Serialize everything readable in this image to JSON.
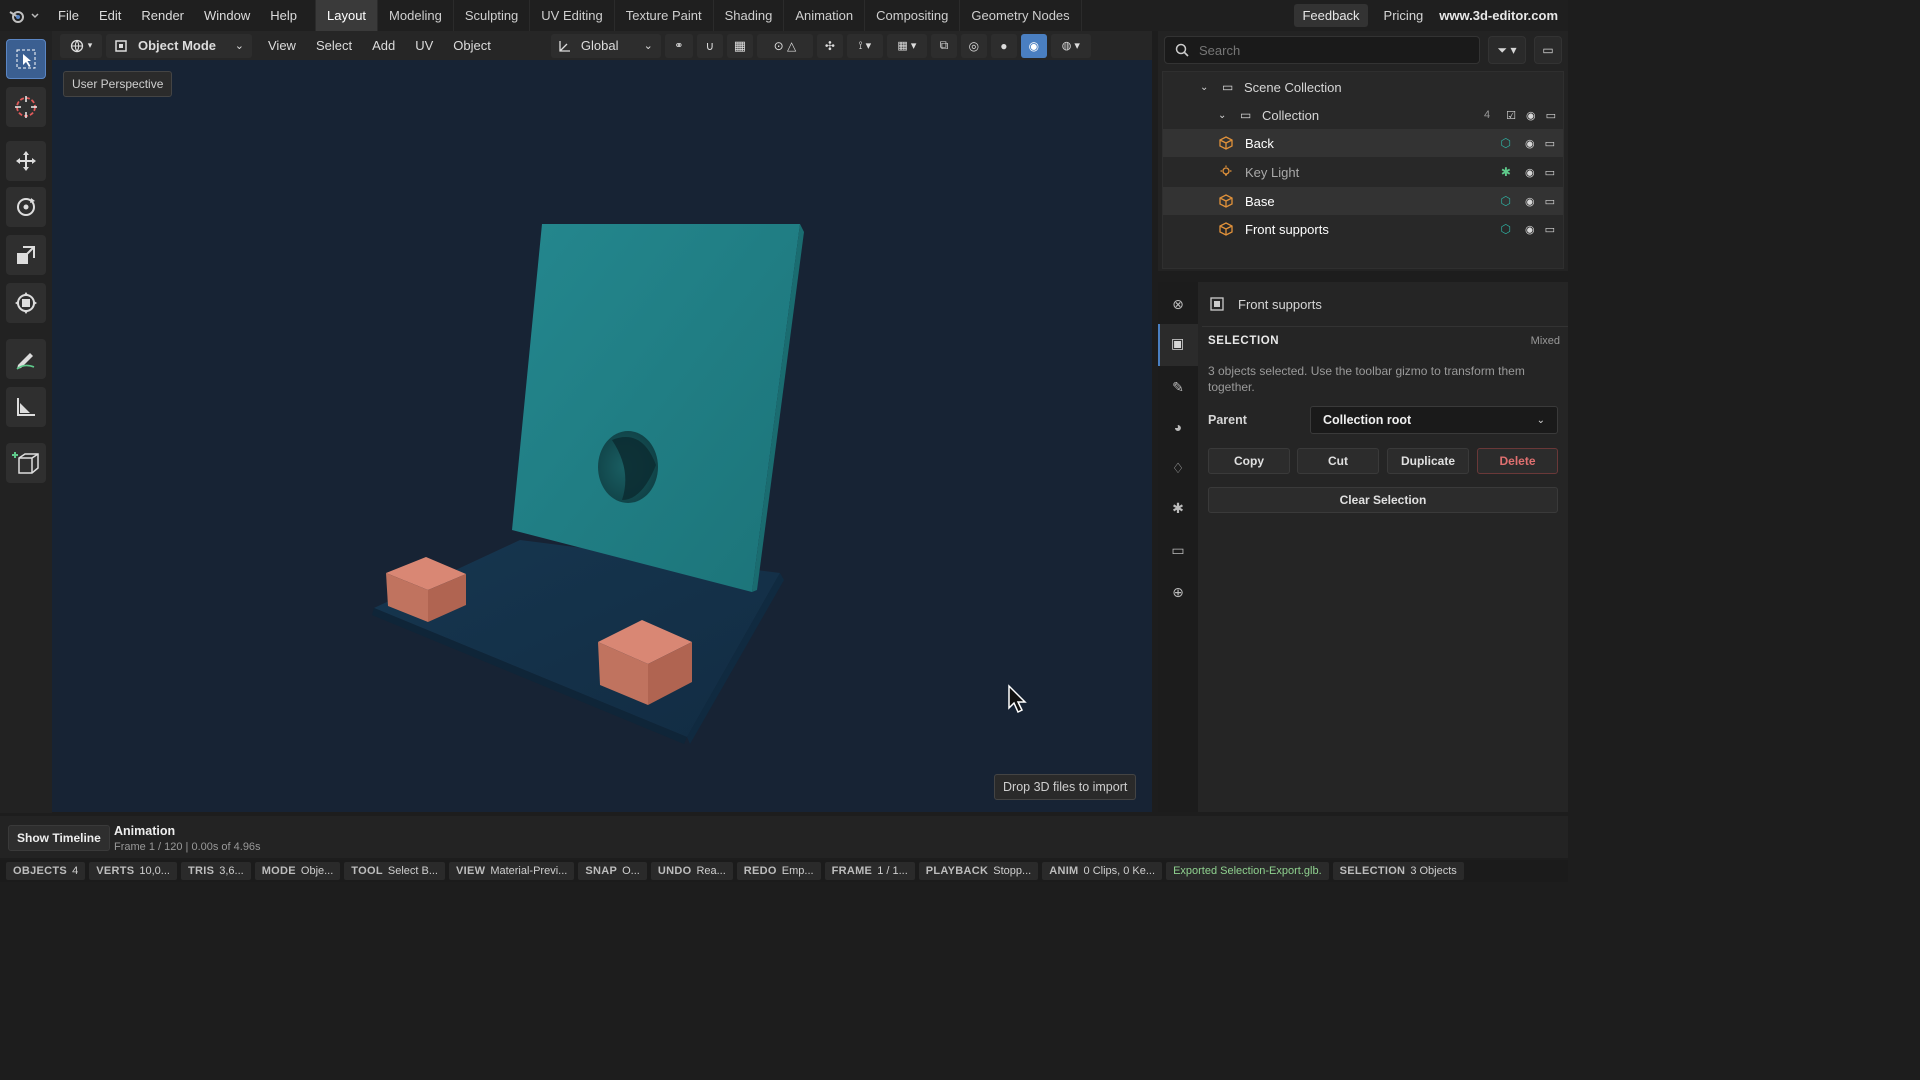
{
  "app": {
    "brand": "www.3d-editor.com"
  },
  "menus": [
    "File",
    "Edit",
    "Render",
    "Window",
    "Help"
  ],
  "workspaces": [
    "Layout",
    "Modeling",
    "Sculpting",
    "UV Editing",
    "Texture Paint",
    "Shading",
    "Animation",
    "Compositing",
    "Geometry Nodes"
  ],
  "active_workspace": "Layout",
  "topright": {
    "feedback": "Feedback",
    "pricing": "Pricing"
  },
  "viewport_header": {
    "mode": "Object Mode",
    "menus": [
      "View",
      "Select",
      "Add",
      "UV",
      "Object"
    ],
    "orientation": "Global"
  },
  "viewport": {
    "perspective_label": "User Perspective",
    "drop_hint": "Drop 3D files to import"
  },
  "outliner": {
    "search_placeholder": "Search",
    "scene_collection": "Scene Collection",
    "collection": "Collection",
    "collection_count": "4",
    "items": [
      {
        "name": "Back",
        "type": "mesh"
      },
      {
        "name": "Key Light",
        "type": "light"
      },
      {
        "name": "Base",
        "type": "mesh"
      },
      {
        "name": "Front supports",
        "type": "mesh"
      }
    ]
  },
  "properties": {
    "object_name": "Front supports",
    "section_title": "SELECTION",
    "section_state": "Mixed",
    "description": "3 objects selected. Use the toolbar gizmo to transform them together.",
    "parent_label": "Parent",
    "parent_value": "Collection root",
    "buttons": {
      "copy": "Copy",
      "cut": "Cut",
      "duplicate": "Duplicate",
      "delete": "Delete",
      "clear": "Clear Selection"
    }
  },
  "timeline": {
    "show_button": "Show Timeline",
    "title": "Animation",
    "subtitle": "Frame 1 / 120 | 0.00s of 4.96s"
  },
  "statusbar": [
    {
      "key": "OBJECTS",
      "value": "4"
    },
    {
      "key": "VERTS",
      "value": "10,0..."
    },
    {
      "key": "TRIS",
      "value": "3,6..."
    },
    {
      "key": "MODE",
      "value": "Obje..."
    },
    {
      "key": "TOOL",
      "value": "Select B..."
    },
    {
      "key": "VIEW",
      "value": "Material-Previ..."
    },
    {
      "key": "SNAP",
      "value": "O..."
    },
    {
      "key": "UNDO",
      "value": "Rea..."
    },
    {
      "key": "REDO",
      "value": "Emp..."
    },
    {
      "key": "FRAME",
      "value": "1 / 1..."
    },
    {
      "key": "PLAYBACK",
      "value": "Stopp..."
    },
    {
      "key": "ANIM",
      "value": "0 Clips, 0 Ke..."
    }
  ],
  "status_message": "Exported Selection-Export.glb.",
  "status_selection": {
    "key": "SELECTION",
    "value": "3 Objects"
  },
  "colors": {
    "accent": "#4a7fc1",
    "mesh_icon": "#e0913a",
    "teal": "#2fb3a4",
    "delete": "#e07070",
    "status_ok": "#8fd18f"
  }
}
